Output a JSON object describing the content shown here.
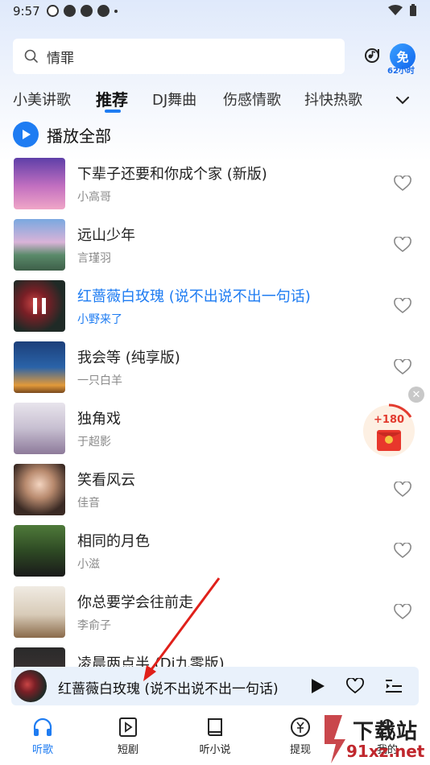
{
  "status_bar": {
    "time": "9:57"
  },
  "search": {
    "query": "情罪"
  },
  "vip": {
    "badge": "免",
    "hours": "62小时"
  },
  "tabs": [
    {
      "label": "小美讲歌"
    },
    {
      "label": "推荐"
    },
    {
      "label": "DJ舞曲"
    },
    {
      "label": "伤感情歌"
    },
    {
      "label": "抖快热歌"
    }
  ],
  "play_all": {
    "label": "播放全部"
  },
  "songs": [
    {
      "title": "下辈子还要和你成个家 (新版)",
      "artist": "小高哥"
    },
    {
      "title": "远山少年",
      "artist": "言瑾羽"
    },
    {
      "title": "红蔷薇白玫瑰 (说不出说不出一句话)",
      "artist": "小野来了"
    },
    {
      "title": "我会等 (纯享版)",
      "artist": "一只白羊"
    },
    {
      "title": "独角戏",
      "artist": "于超影"
    },
    {
      "title": "笑看风云",
      "artist": "佳音"
    },
    {
      "title": "相同的月色",
      "artist": "小滋"
    },
    {
      "title": "你总要学会往前走",
      "artist": "李俞子"
    },
    {
      "title": "凌晨两点半 (Dj九零版)",
      "artist": ""
    }
  ],
  "reward": {
    "amount": "+180"
  },
  "mini_player": {
    "title": "红蔷薇白玫瑰 (说不出说不出一句话)"
  },
  "bottom_nav": [
    {
      "label": "听歌"
    },
    {
      "label": "短剧"
    },
    {
      "label": "听小说"
    },
    {
      "label": "提现"
    },
    {
      "label": "我的"
    }
  ],
  "watermark": {
    "line1": "下载站",
    "line2": "91xz.net"
  },
  "colors": {
    "accent": "#1e7cf2",
    "reward_red": "#e23b2f"
  }
}
